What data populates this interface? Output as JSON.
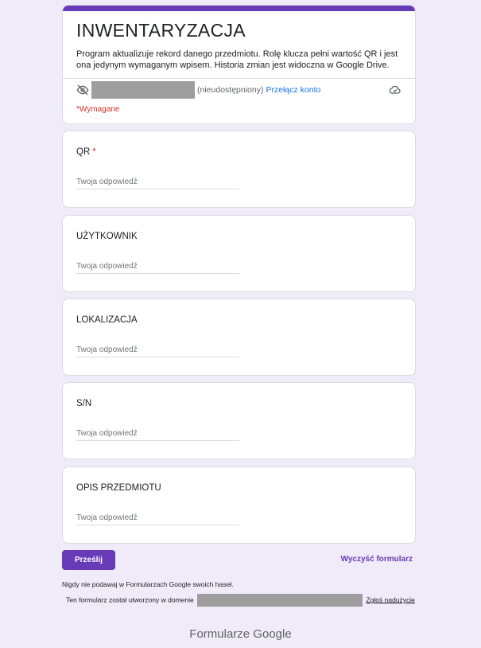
{
  "form": {
    "title": "INWENTARYZACJA",
    "description": "Program aktualizuje rekord danego przedmiotu. Rolę klucza pełni wartość QR i jest ona jedynym wymaganym wpisem. Historia zmian jest widoczna w Google Drive.",
    "not_shared_label": "(nieudostępniony)",
    "switch_account_label": "Przełącz konto",
    "required_note": "*Wymagane"
  },
  "questions": [
    {
      "title": "QR",
      "required_mark": "*",
      "placeholder": "Twoja odpowiedź"
    },
    {
      "title": "UŻYTKOWNIK",
      "placeholder": "Twoja odpowiedź"
    },
    {
      "title": "LOKALIZACJA",
      "placeholder": "Twoja odpowiedź"
    },
    {
      "title": "S/N",
      "placeholder": "Twoja odpowiedź"
    },
    {
      "title": "OPIS PRZEDMIOTU",
      "placeholder": "Twoja odpowiedź"
    }
  ],
  "actions": {
    "submit_label": "Prześlij",
    "clear_label": "Wyczyść formularz"
  },
  "footer": {
    "password_warning": "Nigdy nie podawaj w Formularzach Google swoich haseł.",
    "domain_text": "Ten formularz został utworzony w domenie",
    "report_label": "Zgłoś nadużycie",
    "brand_prefix": "Formularze",
    "brand_name": "Google"
  },
  "colors": {
    "accent": "#673ab7",
    "background": "#f0ebf8",
    "link": "#1a73e8",
    "required": "#d93025"
  },
  "icons": {
    "visibility": "eye-off-icon",
    "cloud": "cloud-saved-icon"
  }
}
